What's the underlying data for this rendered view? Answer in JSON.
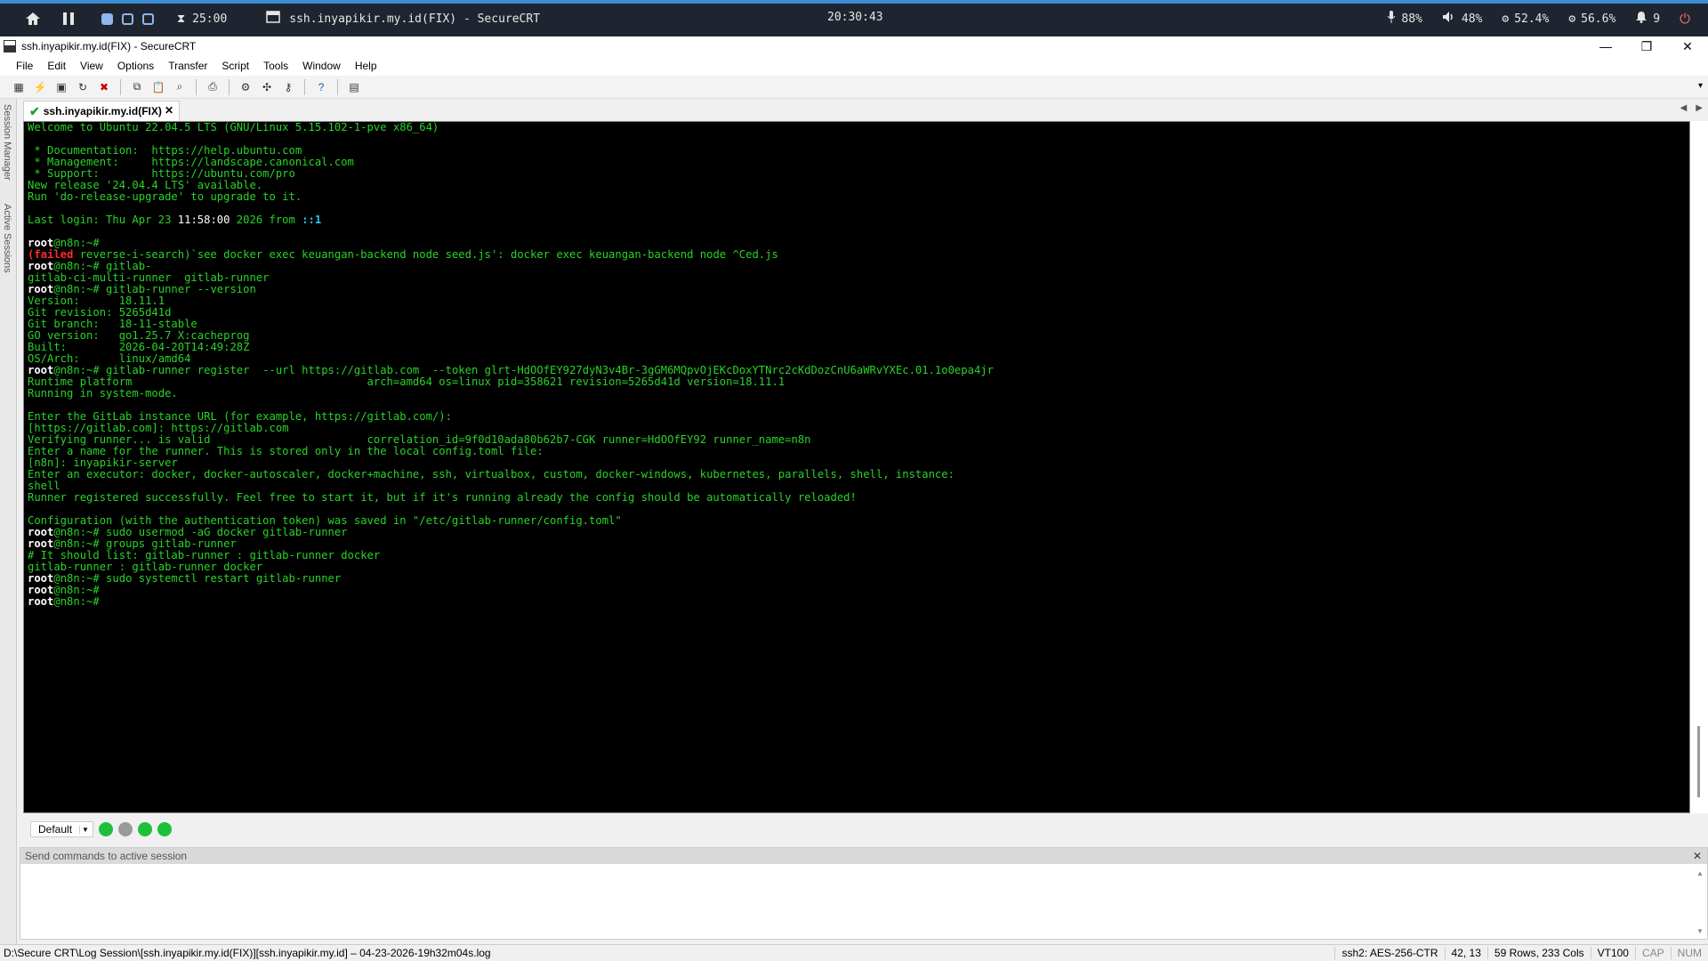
{
  "topbar": {
    "timer": "25:00",
    "window_title": "ssh.inyapikir.my.id(FIX) - SecureCRT",
    "clock": "20:30:43",
    "mic": "88%",
    "volume": "48%",
    "cpu": "52.4%",
    "memory": "56.6%",
    "notifications": "9"
  },
  "window": {
    "title": "ssh.inyapikir.my.id(FIX) - SecureCRT"
  },
  "menu": [
    "File",
    "Edit",
    "View",
    "Options",
    "Transfer",
    "Script",
    "Tools",
    "Window",
    "Help"
  ],
  "left_tabs": {
    "session_manager": "Session Manager",
    "active_sessions": "Active Sessions"
  },
  "session_tab": {
    "label": "ssh.inyapikir.my.id(FIX)"
  },
  "terminal": {
    "colors": {
      "text": "#29d329",
      "prompt": "#ffffff",
      "error": "#ff2a2a",
      "highlight": "#29c8e8"
    },
    "lines": [
      {
        "t": "Welcome to Ubuntu 22.04.5 LTS (GNU/Linux 5.15.102-1-pve x86_64)"
      },
      {
        "t": ""
      },
      {
        "t": " * Documentation:  https://help.ubuntu.com"
      },
      {
        "t": " * Management:     https://landscape.canonical.com"
      },
      {
        "t": " * Support:        https://ubuntu.com/pro"
      },
      {
        "t": "New release '24.04.4 LTS' available."
      },
      {
        "t": "Run 'do-release-upgrade' to upgrade to it."
      },
      {
        "t": ""
      },
      {
        "t": "Last login: Thu Apr 23 ",
        "w": "11:58:00",
        "t2": " 2026 from ",
        "c": "::1"
      },
      {
        "t": ""
      },
      {
        "p": "root",
        "t": "@n8n:~#"
      },
      {
        "r": "(failed",
        "t": " reverse-i-search)`see docker exec keuangan-backend node seed.js': docker exec keuangan-backend node ^Ced.js"
      },
      {
        "p": "root",
        "t": "@n8n:~# gitlab-"
      },
      {
        "t": "gitlab-ci-multi-runner  gitlab-runner"
      },
      {
        "p": "root",
        "t": "@n8n:~# gitlab-runner --version"
      },
      {
        "t": "Version:      18.11.1"
      },
      {
        "t": "Git revision: 5265d41d"
      },
      {
        "t": "Git branch:   18-11-stable"
      },
      {
        "t": "GO version:   go1.25.7 X:cacheprog"
      },
      {
        "t": "Built:        2026-04-20T14:49:28Z"
      },
      {
        "t": "OS/Arch:      linux/amd64"
      },
      {
        "p": "root",
        "t": "@n8n:~# gitlab-runner register  --url https://gitlab.com  --token glrt-HdOOfEY927dyN3v4Br-3gGM6MQpvOjEKcDoxYTNrc2cKdDozCnU6aWRvYXEc.01.1o0epa4jr"
      },
      {
        "t": "Runtime platform                                    arch=amd64 os=linux pid=358621 revision=5265d41d version=18.11.1"
      },
      {
        "t": "Running in system-mode."
      },
      {
        "t": ""
      },
      {
        "t": "Enter the GitLab instance URL (for example, https://gitlab.com/):"
      },
      {
        "t": "[https://gitlab.com]: https://gitlab.com"
      },
      {
        "t": "Verifying runner... is valid                        correlation_id=9f0d10ada80b62b7-CGK runner=HdOOfEY92 runner_name=n8n"
      },
      {
        "t": "Enter a name for the runner. This is stored only in the local config.toml file:"
      },
      {
        "t": "[n8n]: inyapikir-server"
      },
      {
        "t": "Enter an executor: docker, docker-autoscaler, docker+machine, ssh, virtualbox, custom, docker-windows, kubernetes, parallels, shell, instance:"
      },
      {
        "t": "shell"
      },
      {
        "t": "Runner registered successfully. Feel free to start it, but if it's running already the config should be automatically reloaded!"
      },
      {
        "t": ""
      },
      {
        "t": "Configuration (with the authentication token) was saved in \"/etc/gitlab-runner/config.toml\""
      },
      {
        "p": "root",
        "t": "@n8n:~# sudo usermod -aG docker gitlab-runner"
      },
      {
        "p": "root",
        "t": "@n8n:~# groups gitlab-runner"
      },
      {
        "t": "# It should list: gitlab-runner : gitlab-runner docker"
      },
      {
        "t": "gitlab-runner : gitlab-runner docker"
      },
      {
        "p": "root",
        "t": "@n8n:~# sudo systemctl restart gitlab-runner"
      },
      {
        "p": "root",
        "t": "@n8n:~#"
      },
      {
        "p": "root",
        "t": "@n8n:~#"
      }
    ]
  },
  "button_bar": {
    "select_label": "Default",
    "dots": [
      "#1fbf3a",
      "#9a9a9a",
      "#1fbf3a",
      "#1fbf3a"
    ]
  },
  "command_window": {
    "header": "Send commands to active session"
  },
  "statusbar": {
    "log_path": "D:\\Secure CRT\\Log Session\\[ssh.inyapikir.my.id(FIX)][ssh.inyapikir.my.id] – 04-23-2026-19h32m04s.log",
    "cipher": "ssh2: AES-256-CTR",
    "cursor": "42, 13",
    "size": "59 Rows, 233 Cols",
    "emulation": "VT100",
    "cap": "CAP",
    "num": "NUM"
  }
}
